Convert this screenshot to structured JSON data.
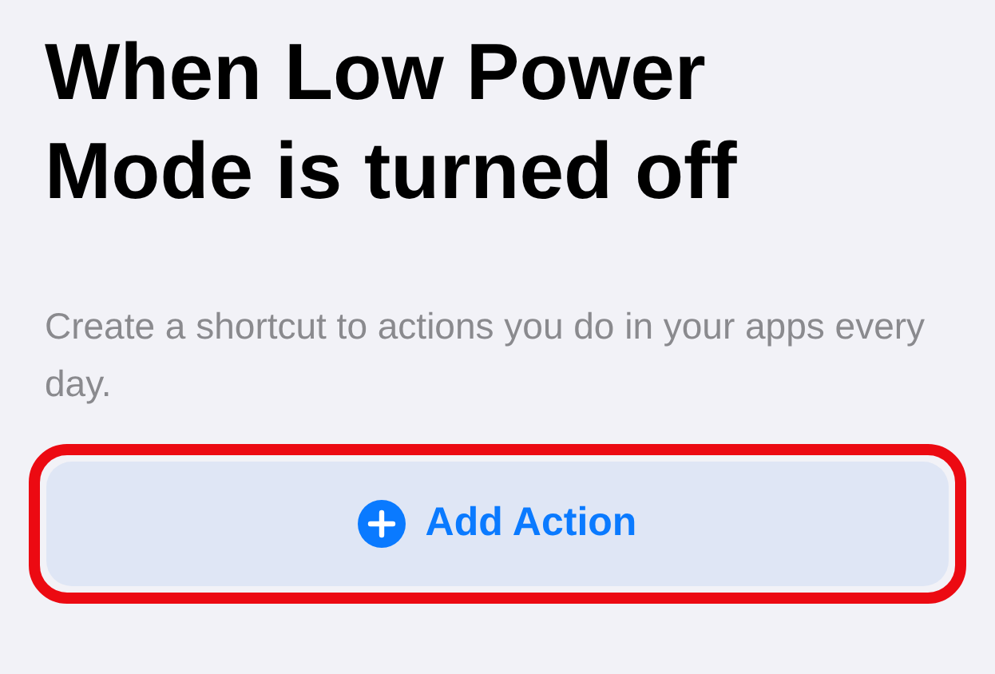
{
  "title": "When Low Power Mode is turned off",
  "description": "Create a shortcut to actions you do in your apps every day.",
  "button": {
    "label": "Add Action",
    "highlighted": true
  }
}
